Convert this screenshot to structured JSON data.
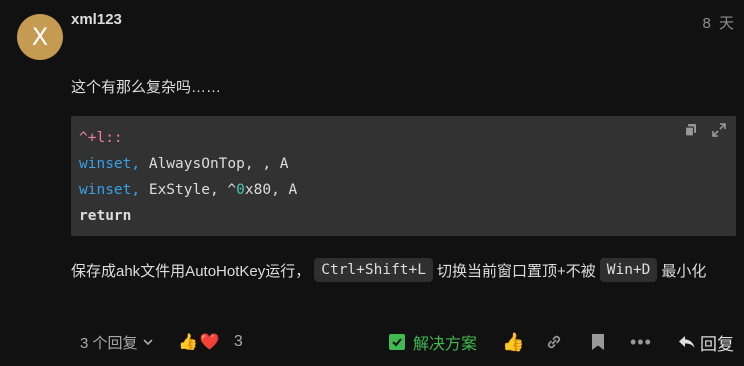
{
  "post": {
    "avatar_letter": "X",
    "avatar_color": "#c59b52",
    "username": "xml123",
    "time": "8 天",
    "text": "这个有那么复杂吗……",
    "code_lines": [
      {
        "parts": [
          {
            "text": "^+l::",
            "cls": "kw-pink"
          }
        ]
      },
      {
        "parts": [
          {
            "text": "winset,",
            "cls": "kw-blue"
          },
          {
            "text": " AlwaysOnTop, , A",
            "cls": ""
          }
        ]
      },
      {
        "parts": [
          {
            "text": "winset,",
            "cls": "kw-blue"
          },
          {
            "text": " ExStyle, ^",
            "cls": ""
          },
          {
            "text": "0",
            "cls": "kw-teal"
          },
          {
            "text": "x80, A",
            "cls": ""
          }
        ]
      },
      {
        "parts": [
          {
            "text": "return",
            "cls": "kw-bold"
          }
        ]
      }
    ],
    "body2": {
      "before": "保存成ahk文件用AutoHotKey运行，",
      "kbd1": "Ctrl+Shift+L",
      "middle": "切换当前窗口置顶+不被",
      "kbd2": "Win+D",
      "after": "最小化"
    }
  },
  "footer": {
    "replies": "3 个回复",
    "reaction_icons": [
      "👍",
      "❤️"
    ],
    "reaction_count": "3",
    "solution_label": "解决方案",
    "like_icon": "👍",
    "more": "•••",
    "reply_label": "回复"
  }
}
